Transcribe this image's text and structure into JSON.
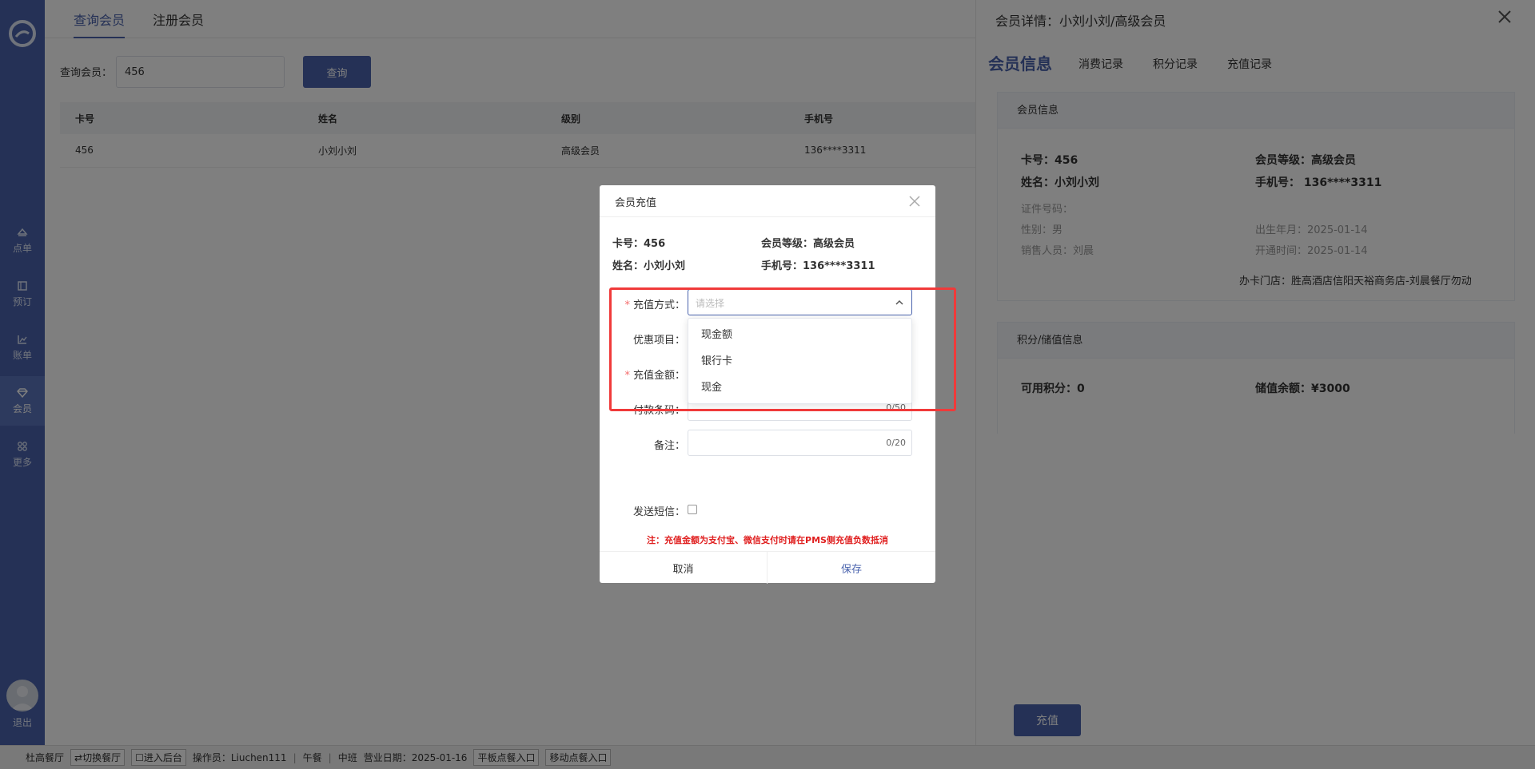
{
  "nav": {
    "items": [
      {
        "label": "点单",
        "icon": "order-icon"
      },
      {
        "label": "预订",
        "icon": "book-icon"
      },
      {
        "label": "账单",
        "icon": "chart-icon"
      },
      {
        "label": "会员",
        "icon": "diamond-icon"
      },
      {
        "label": "更多",
        "icon": "grid-icon"
      }
    ],
    "logout": "退出"
  },
  "top_tabs": [
    "查询会员",
    "注册会员"
  ],
  "search": {
    "label": "查询会员：",
    "value": "456",
    "button": "查询"
  },
  "table": {
    "headers": [
      "卡号",
      "姓名",
      "级别",
      "手机号"
    ],
    "rows": [
      [
        "456",
        "小刘小刘",
        "高级会员",
        "136****3311"
      ]
    ]
  },
  "detail": {
    "title": "会员详情：小刘小刘/高级会员",
    "tabs": [
      "会员信息",
      "消费记录",
      "积分记录",
      "充值记录"
    ],
    "info_title": "会员信息",
    "card": "卡号：456",
    "level": "会员等级：高级会员",
    "name": "姓名：小刘小刘",
    "phone": "手机号： 136****3311",
    "id_no": "证件号码：",
    "gender": "性别：男",
    "birth": "出生年月：2025-01-14",
    "sales": "销售人员：刘晨",
    "open_time": "开通时间：2025-01-14",
    "store": "办卡门店：胜高酒店信阳天裕商务店-刘晨餐厅勿动",
    "points_title": "积分/储值信息",
    "points": "可用积分：0",
    "balance": "储值余额：¥3000",
    "recharge_button": "充值"
  },
  "modal": {
    "title": "会员充值",
    "card": "卡号：456",
    "level": "会员等级：高级会员",
    "name": "姓名：小刘小刘",
    "phone": "手机号：136****3311",
    "method_label": "充值方式：",
    "method_placeholder": "请选择",
    "method_options": [
      "现金额",
      "银行卡",
      "现金"
    ],
    "discount_label": "优惠项目：",
    "amount_label": "充值金额：",
    "barcode_label": "付款条码：",
    "barcode_counter": "0/50",
    "remark_label": "备注：",
    "remark_counter": "0/20",
    "sms_label": "发送短信：",
    "required_mark": "*",
    "note": "注：充值金额为支付宝、微信支付时请在PMS侧充值负数抵消",
    "cancel": "取消",
    "save": "保存"
  },
  "status_bar": {
    "restaurant": "杜高餐厅",
    "switch": "⇄切换餐厅",
    "backend": "☐进入后台",
    "operator": "操作员：Liuchen111",
    "meal": "午餐",
    "shift": "中班",
    "business_date": "营业日期：2025-01-16",
    "tablet": "平板点餐入口",
    "mobile": "移动点餐入口",
    "sep": "|"
  },
  "colors": {
    "primary": "#4a63ad",
    "danger": "#e02020",
    "highlight": "#f03a3a"
  }
}
